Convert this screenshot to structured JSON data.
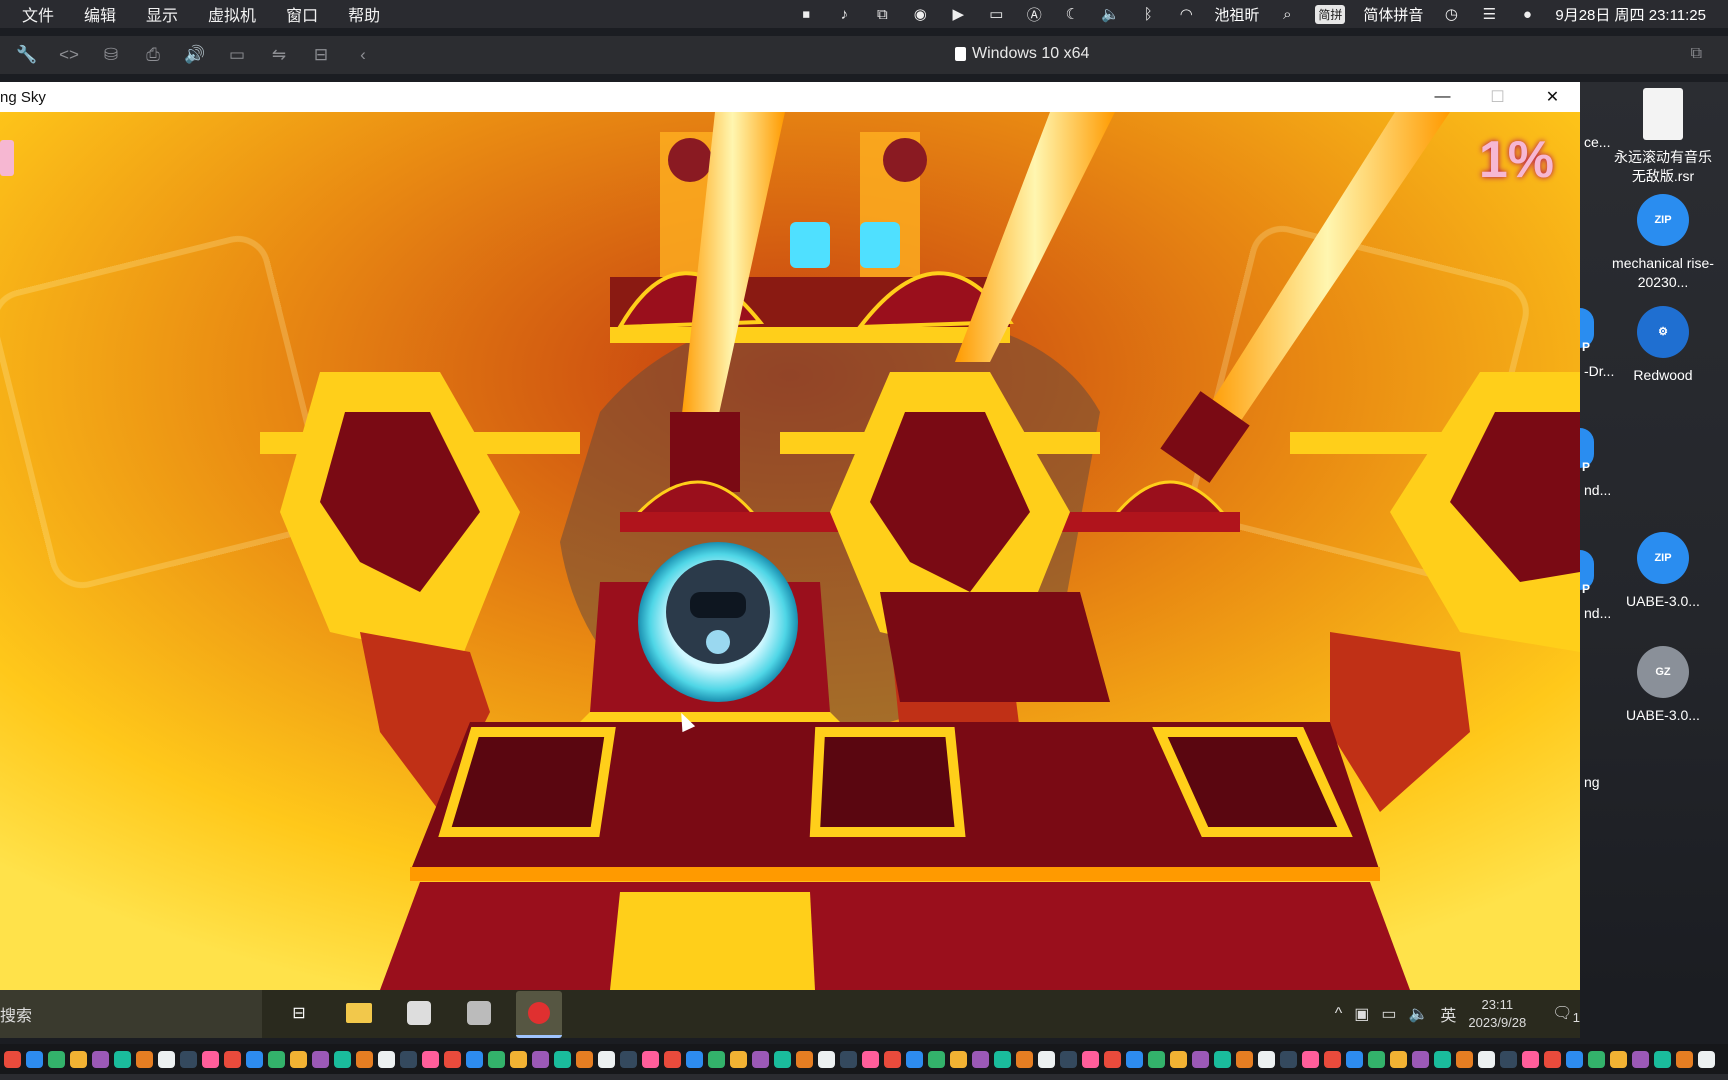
{
  "menubar": {
    "items": [
      "文件",
      "编辑",
      "显示",
      "虚拟机",
      "窗口",
      "帮助"
    ],
    "status": {
      "user": "池祖昕",
      "ime_badge": "简拼",
      "ime": "简体拼音",
      "datetime": "9月28日 周四 23:11:25"
    }
  },
  "vm": {
    "title": "Windows 10 x64"
  },
  "game": {
    "window_title": "ng Sky",
    "progress": "1%"
  },
  "taskbar": {
    "search": "搜索",
    "lang": "英",
    "time": "23:11",
    "date": "2023/9/28",
    "notifications": "1"
  },
  "desktop": {
    "icons": [
      {
        "label": "永远滚动有音乐无敌版.rsr",
        "kind": "document-icon"
      },
      {
        "label": "mechanical rise-20230...",
        "badge": "ZIP"
      },
      {
        "label": "Redwood",
        "kind": "gear-icon"
      },
      {
        "label": "UABE-3.0...",
        "badge": "ZIP"
      },
      {
        "label": "UABE-3.0...",
        "badge": "GZ"
      }
    ],
    "peeks": [
      "ce...",
      "-Dr...",
      "nd...",
      "nd...",
      "ng"
    ],
    "peek_badges": [
      "P",
      "P",
      "P"
    ]
  },
  "colors": {
    "progress_pink": "#f6b7d2",
    "scene_yellow": "#ffcf1a",
    "scene_maroon": "#7a0a14",
    "beam": "#ffd34a",
    "orb": "#4fd6e6"
  }
}
